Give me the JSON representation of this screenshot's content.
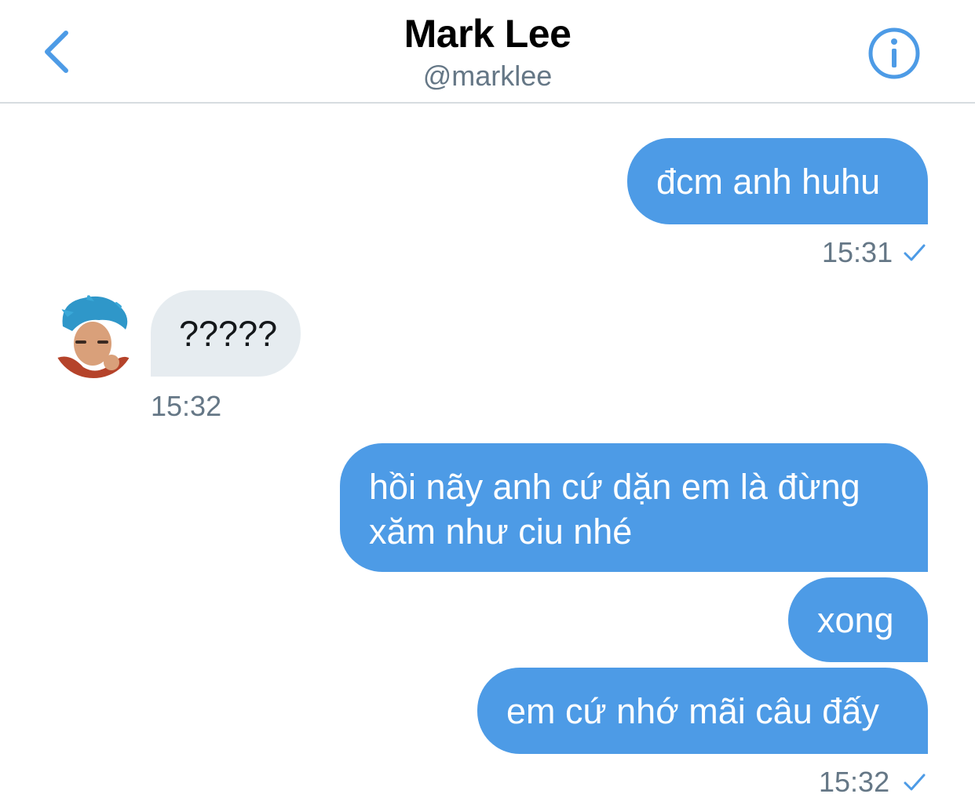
{
  "header": {
    "name": "Mark Lee",
    "handle": "@marklee"
  },
  "messages": [
    {
      "direction": "sent",
      "text": "đcm anh huhu"
    },
    {
      "direction": "received",
      "text": "?????"
    },
    {
      "direction": "sent",
      "lines": [
        "hồi nãy anh cứ dặn em là đừng",
        "xăm như ciu nhé"
      ]
    },
    {
      "direction": "sent",
      "text": "xong"
    },
    {
      "direction": "sent",
      "text": "em cứ nhớ mãi câu đấy"
    }
  ],
  "timestamps": {
    "t1": "15:31",
    "t2": "15:32",
    "t3": "15:32"
  },
  "icons": {
    "back": "chevron-left-icon",
    "info": "info-icon",
    "read_receipt": "checkmark-icon"
  },
  "colors": {
    "accent": "#4d9be6",
    "received_bubble": "#e6ecf0",
    "secondary_text": "#657786"
  }
}
